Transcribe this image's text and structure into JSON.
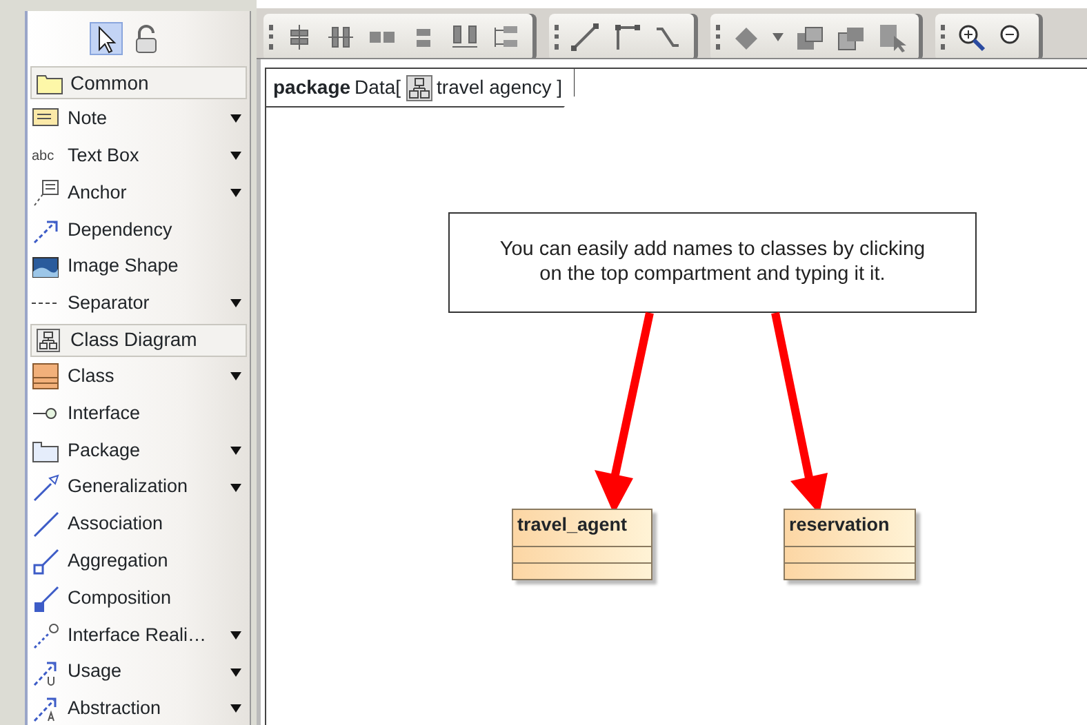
{
  "palette": {
    "selection_tools": [
      {
        "selected": true
      },
      {
        "selected": false
      }
    ],
    "sections": [
      {
        "title": "Common",
        "items": [
          {
            "label": "Note",
            "has_menu": true
          },
          {
            "label": "Text Box",
            "has_menu": true,
            "icon_text": "abc"
          },
          {
            "label": "Anchor",
            "has_menu": true
          },
          {
            "label": "Dependency",
            "has_menu": false
          },
          {
            "label": "Image Shape",
            "has_menu": false
          },
          {
            "label": "Separator",
            "has_menu": true
          }
        ]
      },
      {
        "title": "Class Diagram",
        "items": [
          {
            "label": "Class",
            "has_menu": true
          },
          {
            "label": "Interface",
            "has_menu": false
          },
          {
            "label": "Package",
            "has_menu": true
          },
          {
            "label": "Generalization",
            "has_menu": true
          },
          {
            "label": "Association",
            "has_menu": false
          },
          {
            "label": "Aggregation",
            "has_menu": false
          },
          {
            "label": "Composition",
            "has_menu": false
          },
          {
            "label": "Interface Reali…",
            "has_menu": true
          },
          {
            "label": "Usage",
            "has_menu": true
          },
          {
            "label": "Abstraction",
            "has_menu": true
          }
        ]
      }
    ]
  },
  "diagram": {
    "frame": {
      "keyword": "package",
      "name": "Data[",
      "diagram_name": "travel agency ]"
    },
    "note": {
      "lines": [
        "You can easily add names to classes by clicking",
        "on the top compartment and typing it it."
      ]
    },
    "classes": [
      {
        "name": "travel_agent"
      },
      {
        "name": "reservation"
      }
    ]
  }
}
